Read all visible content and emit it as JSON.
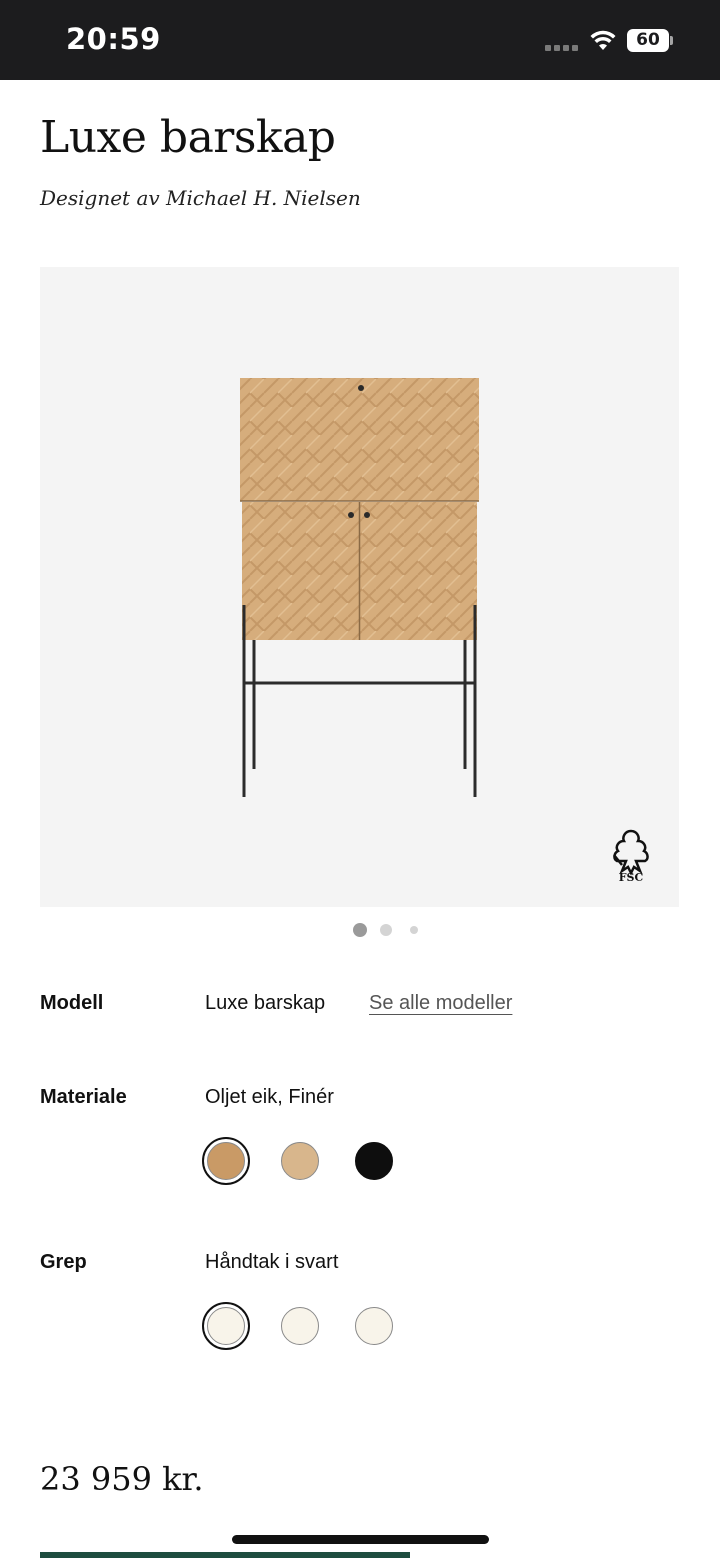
{
  "status_bar": {
    "time": "20:59",
    "battery": "60",
    "icons": [
      "signal-icon",
      "wifi-icon",
      "battery-icon"
    ]
  },
  "product": {
    "title": "Luxe barskap",
    "designer": "Designet av Michael H. Nielsen",
    "fsc_label": "FSC"
  },
  "carousel": {
    "count": 3,
    "active_index": 0
  },
  "options": {
    "model": {
      "label": "Modell",
      "value": "Luxe barskap",
      "link": "Se alle modeller"
    },
    "material": {
      "label": "Materiale",
      "value": "Oljet eik, Finér",
      "swatches": [
        {
          "color": "#c99a66",
          "selected": true
        },
        {
          "color": "#d8b68c",
          "selected": false
        },
        {
          "color": "#0e0e0e",
          "selected": false
        }
      ]
    },
    "handle": {
      "label": "Grep",
      "value": "Håndtak i svart",
      "swatches": [
        {
          "color": "#f8f4ea",
          "selected": true
        },
        {
          "color": "#f8f4ea",
          "selected": false
        },
        {
          "color": "#f8f4ea",
          "selected": false
        }
      ]
    }
  },
  "price": "23 959 kr.",
  "colors": {
    "status_bar_bg": "#1c1c1e",
    "image_bg": "#f4f4f4",
    "cta_green": "#1e4d3f"
  }
}
